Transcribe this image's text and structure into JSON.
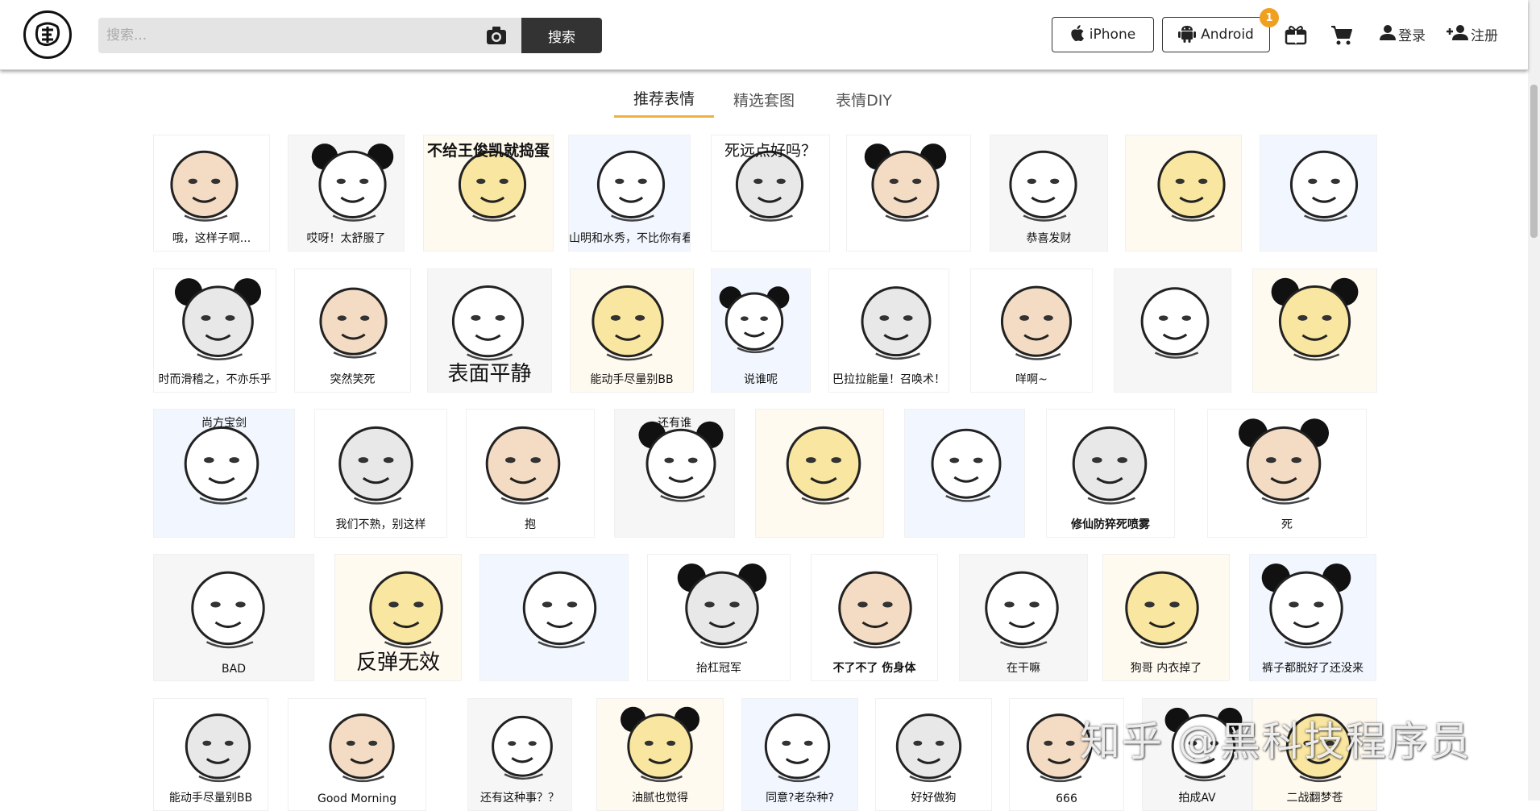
{
  "header": {
    "logo_icon": "doutula-logo-icon",
    "search": {
      "placeholder": "搜索...",
      "value": "",
      "button_label": "搜索",
      "camera_icon": "camera-icon"
    },
    "apps": [
      {
        "label": "iPhone",
        "icon": "apple-icon"
      },
      {
        "label": "Android",
        "icon": "android-icon",
        "badge": "1"
      }
    ],
    "gift_icon": "gift-box-icon",
    "cart_icon": "cart-icon",
    "login_label": "登录",
    "register_label": "注册",
    "accent_color": "#f0a020"
  },
  "tabs": [
    {
      "label": "推荐表情",
      "active": true
    },
    {
      "label": "精选套图",
      "active": false
    },
    {
      "label": "表情DIY",
      "active": false
    }
  ],
  "grid": {
    "rows": [
      [
        "哦，这样子啊...",
        "哎呀！太舒服了",
        "不给王俊凯就捣蛋",
        "山明和水秀，不比你有看头",
        "死远点好吗？",
        "",
        "恭喜发财",
        "",
        ""
      ],
      [
        "时而滑稽之，不亦乐乎",
        "突然笑死",
        "表面平静",
        "能动手尽量别BB",
        "说谁呢",
        "巴拉拉能量！召唤术！",
        "咩啊~",
        "",
        ""
      ],
      [
        "尚方宝剑",
        "我们不熟，别这样",
        "抱",
        "还有谁",
        "",
        "",
        "修仙防猝死喷雾",
        "死"
      ],
      [
        "BAD",
        "反弹无效",
        "",
        "抬杠冠军",
        "不了不了 伤身体",
        "在干嘛",
        "狗哥 内衣掉了",
        "裤子都脱好了还没来"
      ],
      [
        "能动手尽量别BB",
        "Good Morning",
        "还有这种事？？",
        "油腻也觉得",
        "同意?老杂种?",
        "好好做狗",
        "666",
        "拍成AV",
        "二战翻梦苍"
      ]
    ]
  },
  "watermark": "知乎 @黑科技程序员"
}
